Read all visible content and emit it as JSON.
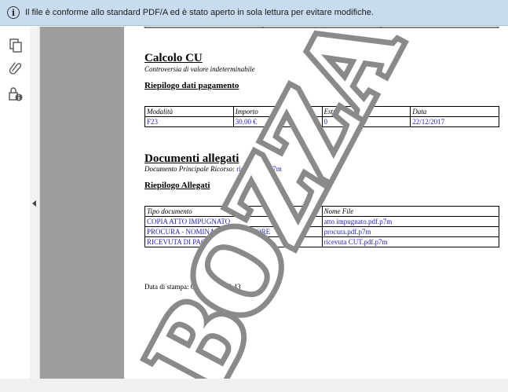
{
  "infobar": {
    "icon": "info-icon",
    "icon_glyph": "i",
    "message": "Il file è conforme allo standard PDF/A ed è stato aperto in sola lettura per evitare modifiche."
  },
  "toolrail": {
    "tools": [
      "pages-icon",
      "attachments-icon",
      "security-icon"
    ]
  },
  "document": {
    "calcolo": {
      "title": "Calcolo CU",
      "subtitle": "Controversia di valore indeterminabile",
      "riepilogo_title": "Riepilogo dati pagamento",
      "headers": [
        "Modalità",
        "Importo",
        "Estremi",
        "Data"
      ],
      "rows": [
        [
          "F23",
          "30,00 €",
          "0",
          "22/12/2017"
        ]
      ]
    },
    "documenti": {
      "title": "Documenti allegati",
      "principale_label": "Documento Principale Ricorso:",
      "principale_value": "ricorso.pdf.p7m",
      "riepilogo_title": "Riepilogo Allegati",
      "headers": [
        "Tipo documento",
        "Nome File"
      ],
      "rows": [
        [
          "COPIA ATTO IMPUGNATO",
          "atto impugnato.pdf.p7m"
        ],
        [
          "PROCURA - NOMINA DEL DIFENSORE",
          "procura.pdf.p7m"
        ],
        [
          "RICEVUTA DI PAGAMENTO CUT",
          "ricevuta CUT.pdf.p7m"
        ]
      ]
    },
    "stampa": "Data di stampa: 05/01/2018 18:43",
    "watermark": "BOZZA"
  },
  "colors": {
    "infobar_bg": "#c9dcef",
    "link_blue": "#2323c8",
    "viewer_grey": "#9e9e9e",
    "watermark": "#8a8a8a"
  }
}
